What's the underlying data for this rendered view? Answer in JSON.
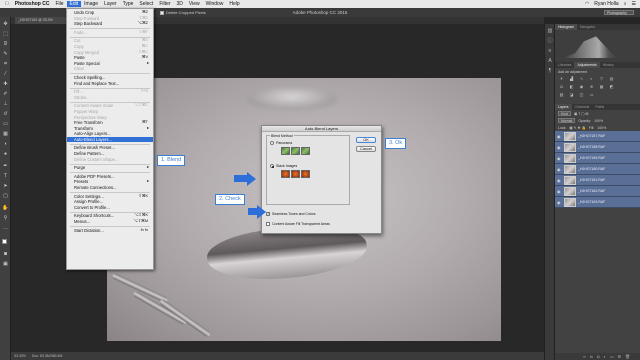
{
  "macbar": {
    "apple": "",
    "items": [
      "Photoshop CC",
      "File",
      "Edit",
      "Image",
      "Layer",
      "Type",
      "Select",
      "Filter",
      "3D",
      "View",
      "Window",
      "Help"
    ],
    "user": "Ryan Holla"
  },
  "app_title": "Adobe Photoshop CC 2015",
  "options_bar": {
    "delete_cropped_label": "Delete Cropped Pixels"
  },
  "workspace": "Photography",
  "doc_tab": "_HJHO7162 @ 33.3%",
  "status": {
    "zoom": "33.33%",
    "doc": "Doc: 83.3M/389.4M"
  },
  "edit_menu": {
    "items": [
      {
        "label": "Undo Crop",
        "shortcut": "⌘Z",
        "dim": false,
        "type": "item"
      },
      {
        "label": "Step Forward",
        "shortcut": "⇧⌘Z",
        "dim": true,
        "type": "item"
      },
      {
        "label": "Step Backward",
        "shortcut": "⌥⌘Z",
        "dim": false,
        "type": "item"
      },
      {
        "type": "sep"
      },
      {
        "label": "Fade...",
        "shortcut": "⇧⌘F",
        "dim": true,
        "type": "item"
      },
      {
        "type": "sep"
      },
      {
        "label": "Cut",
        "shortcut": "⌘X",
        "dim": true,
        "type": "item"
      },
      {
        "label": "Copy",
        "shortcut": "⌘C",
        "dim": true,
        "type": "item"
      },
      {
        "label": "Copy Merged",
        "shortcut": "⇧⌘C",
        "dim": true,
        "type": "item"
      },
      {
        "label": "Paste",
        "shortcut": "⌘V",
        "dim": false,
        "type": "item"
      },
      {
        "label": "Paste Special",
        "shortcut": "▸",
        "dim": false,
        "type": "item"
      },
      {
        "label": "Clear",
        "shortcut": "",
        "dim": true,
        "type": "item"
      },
      {
        "type": "sep"
      },
      {
        "label": "Check Spelling...",
        "shortcut": "",
        "dim": false,
        "type": "item"
      },
      {
        "label": "Find and Replace Text...",
        "shortcut": "",
        "dim": false,
        "type": "item"
      },
      {
        "type": "sep"
      },
      {
        "label": "Fill...",
        "shortcut": "⇧F5",
        "dim": true,
        "type": "item"
      },
      {
        "label": "Stroke...",
        "shortcut": "",
        "dim": true,
        "type": "item"
      },
      {
        "type": "sep"
      },
      {
        "label": "Content-Aware Scale",
        "shortcut": "⌥⇧⌘C",
        "dim": true,
        "type": "item"
      },
      {
        "label": "Puppet Warp",
        "shortcut": "",
        "dim": true,
        "type": "item"
      },
      {
        "label": "Perspective Warp",
        "shortcut": "",
        "dim": true,
        "type": "item"
      },
      {
        "label": "Free Transform",
        "shortcut": "⌘T",
        "dim": false,
        "type": "item"
      },
      {
        "label": "Transform",
        "shortcut": "▸",
        "dim": false,
        "type": "item"
      },
      {
        "label": "Auto-Align Layers...",
        "shortcut": "",
        "dim": false,
        "type": "item"
      },
      {
        "label": "Auto-Blend Layers...",
        "shortcut": "",
        "dim": false,
        "type": "item",
        "highlight": true
      },
      {
        "type": "sep"
      },
      {
        "label": "Define Brush Preset...",
        "shortcut": "",
        "dim": false,
        "type": "item"
      },
      {
        "label": "Define Pattern...",
        "shortcut": "",
        "dim": false,
        "type": "item"
      },
      {
        "label": "Define Custom Shape...",
        "shortcut": "",
        "dim": true,
        "type": "item"
      },
      {
        "type": "sep"
      },
      {
        "label": "Purge",
        "shortcut": "▸",
        "dim": false,
        "type": "item"
      },
      {
        "type": "sep"
      },
      {
        "label": "Adobe PDF Presets...",
        "shortcut": "",
        "dim": false,
        "type": "item"
      },
      {
        "label": "Presets",
        "shortcut": "▸",
        "dim": false,
        "type": "item"
      },
      {
        "label": "Remote Connections...",
        "shortcut": "",
        "dim": false,
        "type": "item"
      },
      {
        "type": "sep"
      },
      {
        "label": "Color Settings...",
        "shortcut": "⇧⌘K",
        "dim": false,
        "type": "item"
      },
      {
        "label": "Assign Profile...",
        "shortcut": "",
        "dim": false,
        "type": "item"
      },
      {
        "label": "Convert to Profile...",
        "shortcut": "",
        "dim": false,
        "type": "item"
      },
      {
        "type": "sep"
      },
      {
        "label": "Keyboard Shortcuts...",
        "shortcut": "⌥⇧⌘K",
        "dim": false,
        "type": "item"
      },
      {
        "label": "Menus...",
        "shortcut": "⌥⇧⌘M",
        "dim": false,
        "type": "item"
      },
      {
        "type": "sep"
      },
      {
        "label": "Start Dictation...",
        "shortcut": "fn fn",
        "dim": false,
        "type": "item"
      }
    ]
  },
  "callouts": {
    "blend": "1. Blend",
    "check": "2. Check",
    "ok": "3. Ok"
  },
  "dialog": {
    "title": "Auto-Blend Layers",
    "group_label": "Blend Method",
    "panorama": "Panorama",
    "stack": "Stack Images",
    "seamless": "Seamless Tones and Colors",
    "content_aware": "Content Aware Fill Transparent Areas",
    "ok": "OK",
    "cancel": "Cancel"
  },
  "panels": {
    "tabs_top": [
      "Histogram",
      "Navigator"
    ],
    "tabs_mid": [
      "Libraries",
      "Adjustments",
      "History"
    ],
    "add_adjustment": "Add an adjustment",
    "tabs_layers": [
      "Layers",
      "Channels",
      "Paths"
    ],
    "kind": "Kind",
    "blend_mode": "Normal",
    "opacity_label": "Opacity:",
    "opacity": "100%",
    "lock_label": "Lock:",
    "fill_label": "Fill:",
    "fill": "100%",
    "layers": [
      "_HJHO7157.RAF",
      "_HJHO7158.RAF",
      "_HJHO7159.RAF",
      "_HJHO7160.RAF",
      "_HJHO7161.RAF",
      "_HJHO7162.RAF",
      "_HJHO7163.RAF"
    ]
  }
}
